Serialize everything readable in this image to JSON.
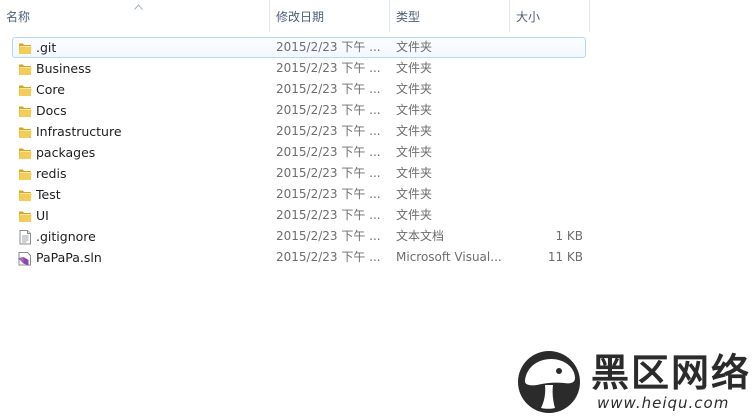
{
  "columns": {
    "name": "名称",
    "date": "修改日期",
    "type": "类型",
    "size": "大小"
  },
  "sort": {
    "column": "name",
    "direction": "ascending"
  },
  "files": [
    {
      "name": ".git",
      "date": "2015/2/23 下午 ...",
      "type": "文件夹",
      "size": "",
      "icon": "folder-icon",
      "highlighted": true
    },
    {
      "name": "Business",
      "date": "2015/2/23 下午 ...",
      "type": "文件夹",
      "size": "",
      "icon": "folder-icon"
    },
    {
      "name": "Core",
      "date": "2015/2/23 下午 ...",
      "type": "文件夹",
      "size": "",
      "icon": "folder-icon"
    },
    {
      "name": "Docs",
      "date": "2015/2/23 下午 ...",
      "type": "文件夹",
      "size": "",
      "icon": "folder-icon"
    },
    {
      "name": "Infrastructure",
      "date": "2015/2/23 下午 ...",
      "type": "文件夹",
      "size": "",
      "icon": "folder-icon"
    },
    {
      "name": "packages",
      "date": "2015/2/23 下午 ...",
      "type": "文件夹",
      "size": "",
      "icon": "folder-icon"
    },
    {
      "name": "redis",
      "date": "2015/2/23 下午 ...",
      "type": "文件夹",
      "size": "",
      "icon": "folder-icon"
    },
    {
      "name": "Test",
      "date": "2015/2/23 下午 ...",
      "type": "文件夹",
      "size": "",
      "icon": "folder-icon"
    },
    {
      "name": "UI",
      "date": "2015/2/23 下午 ...",
      "type": "文件夹",
      "size": "",
      "icon": "folder-icon"
    },
    {
      "name": ".gitignore",
      "date": "2015/2/23 下午 ...",
      "type": "文本文档",
      "size": "1 KB",
      "icon": "text-document-icon"
    },
    {
      "name": "PaPaPa.sln",
      "date": "2015/2/23 下午 ...",
      "type": "Microsoft Visual...",
      "size": "11 KB",
      "icon": "visual-studio-solution-icon"
    }
  ],
  "watermark": {
    "chinese": "黑区网络",
    "url": "www.heiqu.com"
  },
  "colors": {
    "folder": "#f1c64a",
    "folder_dark": "#d9a521",
    "highlight_border": "#b8d6fb",
    "header_text": "#4c607a",
    "watermark": "#2b2b2b"
  }
}
